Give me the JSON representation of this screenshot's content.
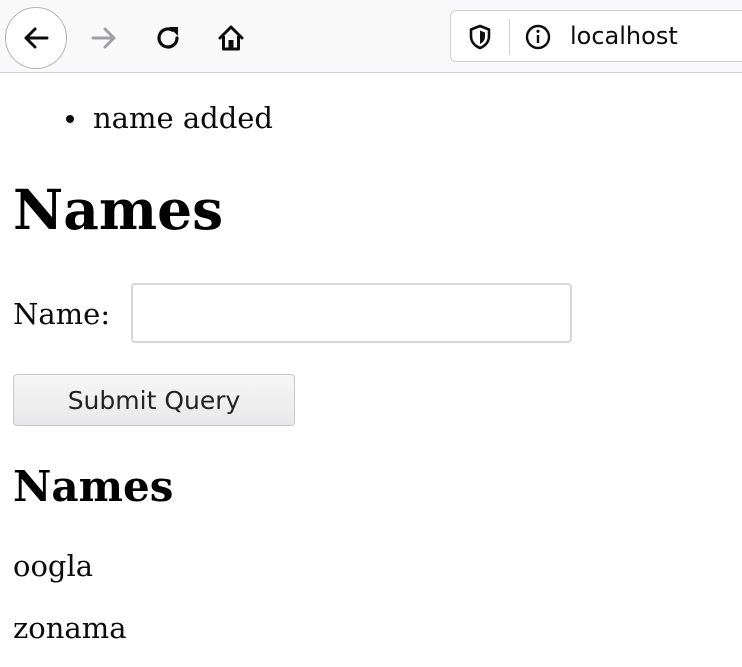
{
  "browser": {
    "url": "localhost",
    "icons": {
      "back": "arrow-left-icon",
      "forward": "arrow-right-icon",
      "reload": "reload-icon",
      "home": "home-icon",
      "shield": "tracking-shield-icon",
      "info": "site-info-icon"
    }
  },
  "page": {
    "flash_messages": [
      "name added"
    ],
    "title": "Names",
    "form": {
      "label": "Name:",
      "input_value": "",
      "submit_label": "Submit Query"
    },
    "list_heading": "Names",
    "names": [
      "oogla",
      "zonama"
    ]
  }
}
